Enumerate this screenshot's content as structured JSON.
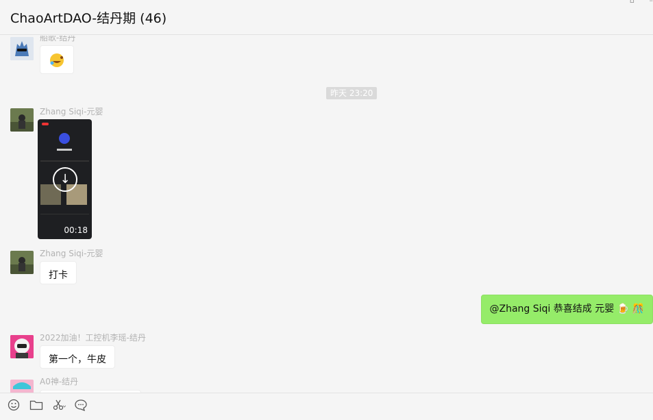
{
  "header": {
    "title": "ChaoArtDAO-结丹期 (46)",
    "pin_icon": "pin-icon",
    "minimize_icon": "minimize-icon"
  },
  "messages": {
    "m1": {
      "sender": "船歌-结丹"
    },
    "timestamp": "昨天 23:20",
    "m2": {
      "sender": "Zhang Siqi-元婴",
      "video_duration": "00:18"
    },
    "m3": {
      "sender": "Zhang Siqi-元婴",
      "text": "打卡"
    },
    "m4": {
      "text": "@Zhang Siqi 恭喜结成 元婴 🍺 🎊"
    },
    "m5": {
      "sender": "2022加油！工控机李瑶-结丹",
      "text": "第一个，牛皮"
    },
    "m6": {
      "sender": "A0神-结丹"
    }
  },
  "toolbar": {
    "emoji_icon": "emoji-icon",
    "folder_icon": "folder-icon",
    "scissors_icon": "scissors-icon",
    "chat_icon": "chat-bubble-icon"
  }
}
